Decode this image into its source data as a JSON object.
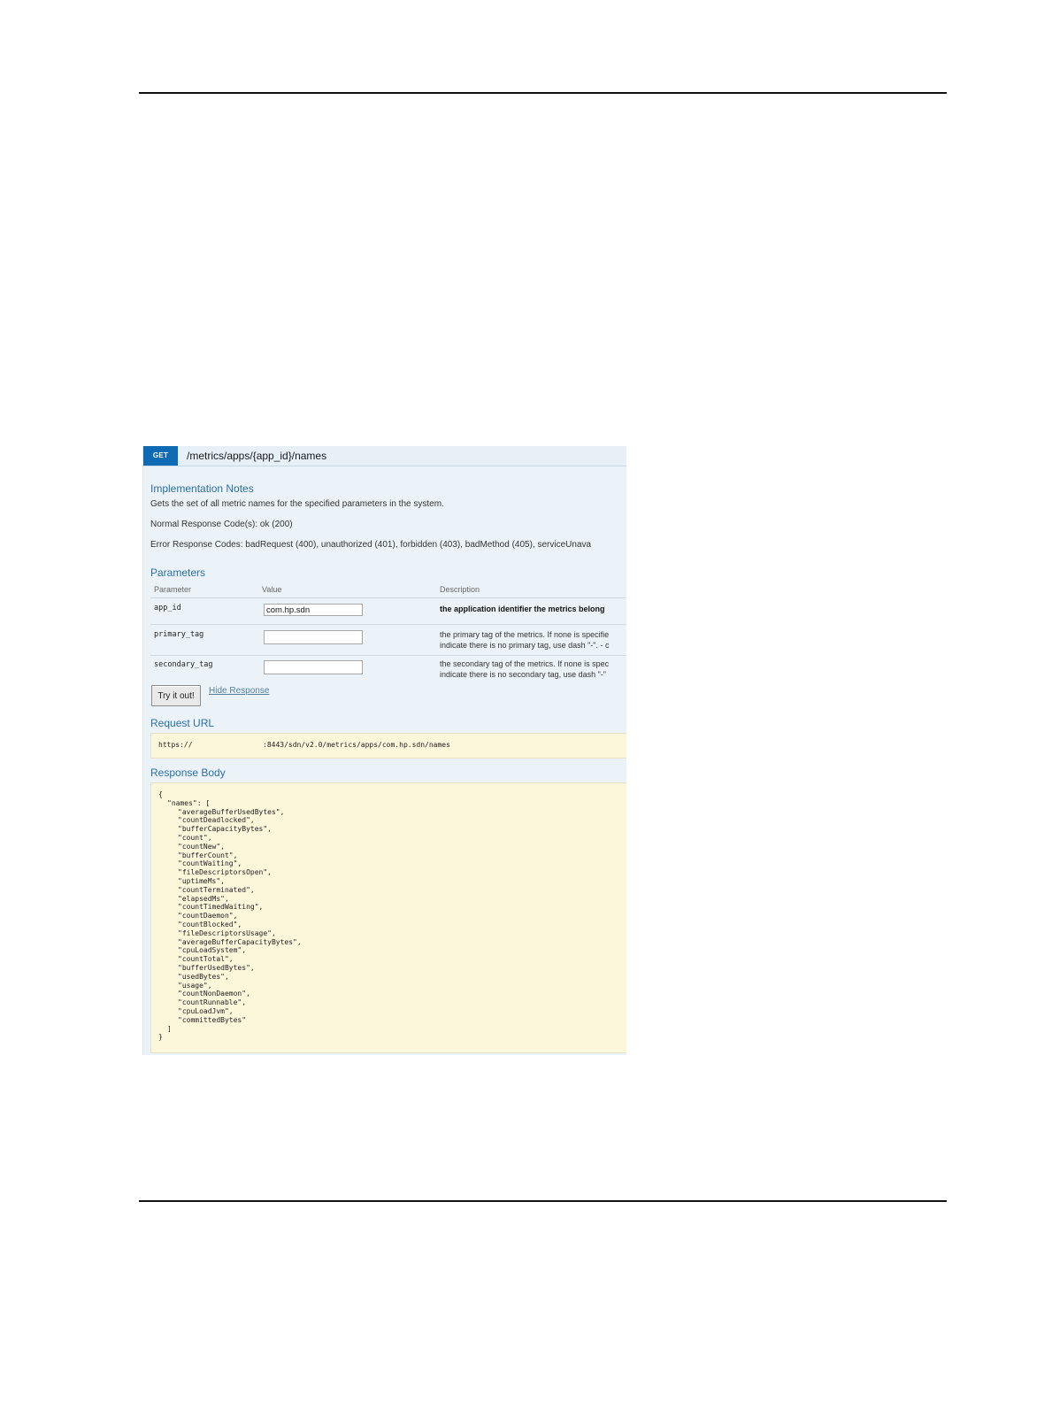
{
  "operation": {
    "method": "GET",
    "path": "/metrics/apps/{app_id}/names"
  },
  "implementation_notes": {
    "heading": "Implementation Notes",
    "description": "Gets the set of all metric names for the specified parameters in the system.",
    "normal_codes": "Normal Response Code(s): ok (200)",
    "error_codes": "Error Response Codes: badRequest (400), unauthorized (401), forbidden (403), badMethod (405), serviceUnava"
  },
  "parameters": {
    "heading": "Parameters",
    "columns": [
      "Parameter",
      "Value",
      "Description"
    ],
    "rows": [
      {
        "name": "app_id",
        "value": "com.hp.sdn",
        "description_line1": "the application identifier the metrics belong",
        "description_line2": ""
      },
      {
        "name": "primary_tag",
        "value": "",
        "description_line1": "the primary tag of the metrics. If none is specifie",
        "description_line2": "indicate there is no primary tag, use dash \"-\". - c"
      },
      {
        "name": "secondary_tag",
        "value": "",
        "description_line1": "the secondary tag of the metrics. If none is spec",
        "description_line2": "indicate there is no secondary tag, use dash \"-\""
      }
    ]
  },
  "actions": {
    "try_label": "Try it out!",
    "hide_label": "Hide Response"
  },
  "request_url": {
    "heading": "Request URL",
    "scheme": "https://",
    "rest": ":8443/sdn/v2.0/metrics/apps/com.hp.sdn/names"
  },
  "response_body": {
    "heading": "Response Body",
    "open_brace": "{",
    "key_line": "\"names\": [",
    "names": [
      "\"averageBufferUsedBytes\",",
      "\"countDeadlocked\",",
      "\"bufferCapacityBytes\",",
      "\"count\",",
      "\"countNew\",",
      "\"bufferCount\",",
      "\"countWaiting\",",
      "\"fileDescriptorsOpen\",",
      "\"uptimeMs\",",
      "\"countTerminated\",",
      "\"elapsedMs\",",
      "\"countTimedWaiting\",",
      "\"countDaemon\",",
      "\"countBlocked\",",
      "\"fileDescriptorsUsage\",",
      "\"averageBufferCapacityBytes\",",
      "\"cpuLoadSystem\",",
      "\"countTotal\",",
      "\"bufferUsedBytes\",",
      "\"usedBytes\",",
      "\"usage\",",
      "\"countNonDaemon\",",
      "\"countRunnable\",",
      "\"cpuLoadJvm\",",
      "\"committedBytes\""
    ],
    "close_bracket": "]",
    "close_brace": "}"
  }
}
